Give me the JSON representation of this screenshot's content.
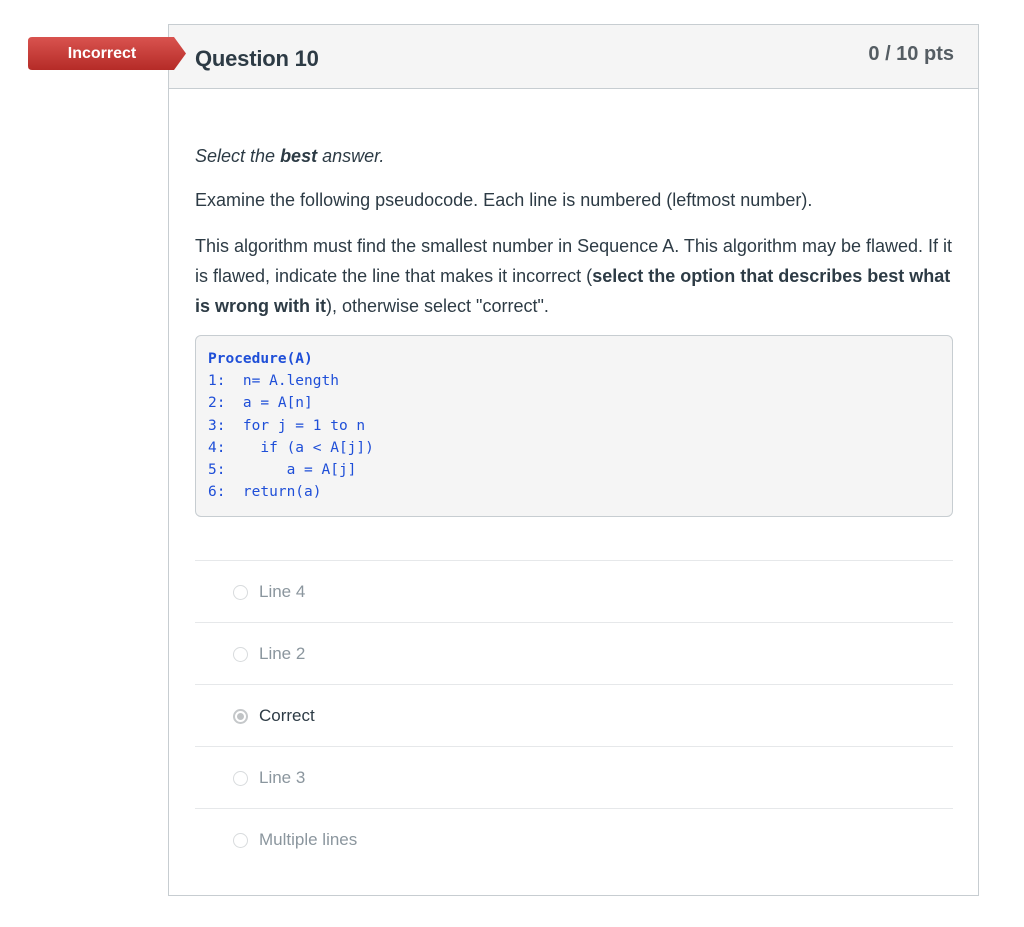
{
  "status": {
    "label": "Incorrect",
    "color": "#c8312c"
  },
  "question": {
    "title": "Question 10",
    "points": "0 / 10 pts",
    "instruction_prefix": "Select the ",
    "instruction_bold": "best",
    "instruction_suffix": " answer.",
    "paragraph1": "Examine the following pseudocode. Each line is numbered (leftmost number).",
    "paragraph2_text": "This algorithm must find the smallest number in Sequence A. This algorithm may be flawed. If it is flawed, indicate the line that makes it incorrect (",
    "paragraph2_bold": "select the option that describes best what is wrong with it",
    "paragraph2_suffix": "), otherwise select \"correct\"."
  },
  "code": {
    "title": "Procedure(A)",
    "lines": [
      "1:  n= A.length",
      "2:  a = A[n]",
      "3:  for j = 1 to n",
      "4:    if (a < A[j])",
      "5:       a = A[j]",
      "6:  return(a)"
    ]
  },
  "answers": [
    {
      "label": "Line 4",
      "selected": false
    },
    {
      "label": "Line 2",
      "selected": false
    },
    {
      "label": "Correct",
      "selected": true
    },
    {
      "label": "Line 3",
      "selected": false
    },
    {
      "label": "Multiple lines",
      "selected": false
    }
  ]
}
